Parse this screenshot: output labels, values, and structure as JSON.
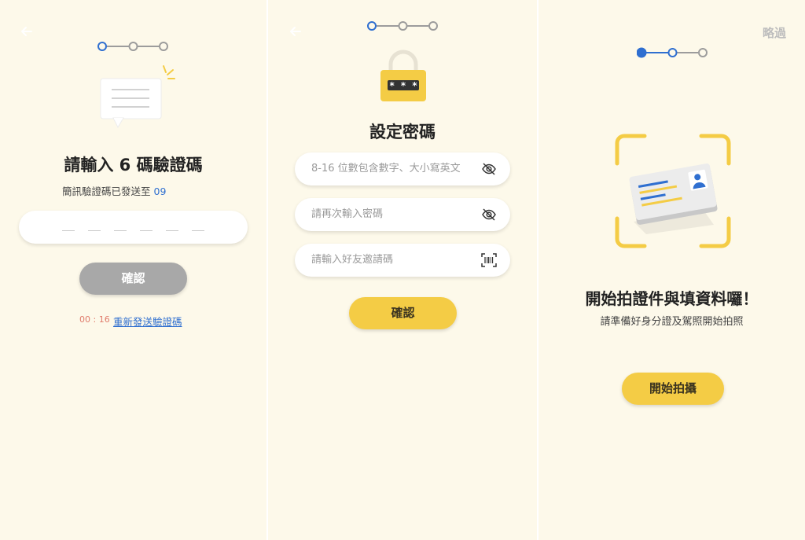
{
  "screen1": {
    "title": "請輸入 6 碼驗證碼",
    "sms_text": "簡訊驗證碼已發送至",
    "phone_partial": "09",
    "code_slots": [
      "—",
      "—",
      "—",
      "—",
      "—",
      "—"
    ],
    "confirm_label": "確認",
    "timer": "00 : 16",
    "resend_label": "重新發送驗證碼",
    "step": 1
  },
  "screen2": {
    "title": "設定密碼",
    "password_placeholder": "8-16 位數包含數字、大小寫英文",
    "confirm_password_placeholder": "請再次輸入密碼",
    "invite_code_placeholder": "請輸入好友邀請碼",
    "lock_text": "* * *",
    "confirm_label": "確認",
    "step": 1
  },
  "screen3": {
    "skip_label": "略過",
    "title": "開始拍證件與填資料囉！",
    "subtitle": "請準備好身分證及駕照開始拍照",
    "start_label": "開始拍攝",
    "step": 2
  },
  "colors": {
    "background": "#fdf9ea",
    "accent_yellow": "#f4cc45",
    "accent_blue": "#2f6fd0",
    "disabled_grey": "#a8a8a8",
    "step_inactive": "#9c9c9c"
  }
}
